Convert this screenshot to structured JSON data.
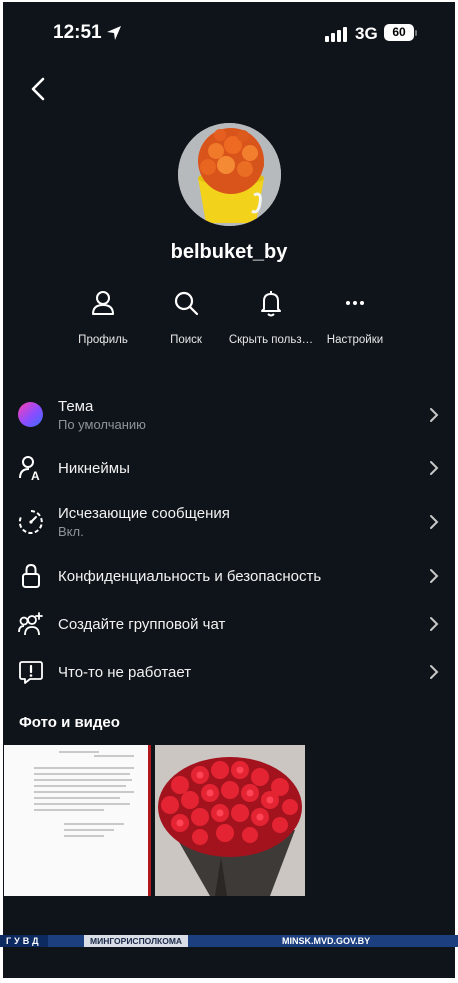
{
  "status_bar": {
    "time": "12:51",
    "network": "3G",
    "battery": "60"
  },
  "profile": {
    "username": "belbuket_by"
  },
  "actions": [
    {
      "label": "Профиль",
      "icon": "person-icon"
    },
    {
      "label": "Поиск",
      "icon": "search-icon"
    },
    {
      "label": "Скрыть польз…",
      "icon": "bell-icon"
    },
    {
      "label": "Настройки",
      "icon": "more-icon"
    }
  ],
  "settings": [
    {
      "title": "Тема",
      "subtitle": "По умолчанию",
      "icon": "theme-color-icon"
    },
    {
      "title": "Никнеймы",
      "icon": "nickname-icon"
    },
    {
      "title": "Исчезающие сообщения",
      "subtitle": "Вкл.",
      "icon": "timer-icon"
    },
    {
      "title": "Конфиденциальность и безопасность",
      "icon": "lock-icon"
    },
    {
      "title": "Создайте групповой чат",
      "icon": "group-add-icon"
    },
    {
      "title": "Что-то не работает",
      "icon": "report-icon"
    }
  ],
  "media": {
    "title": "Фото и видео"
  },
  "footer": {
    "tag": "ГУВД",
    "org": "МИНГОРИСПОЛКОМА",
    "url": "MINSK.MVD.GOV.BY"
  },
  "colors": {
    "background": "#0f141a",
    "text": "#f2f2f2",
    "muted": "#8e949a",
    "footer": "#1c3f7f"
  }
}
